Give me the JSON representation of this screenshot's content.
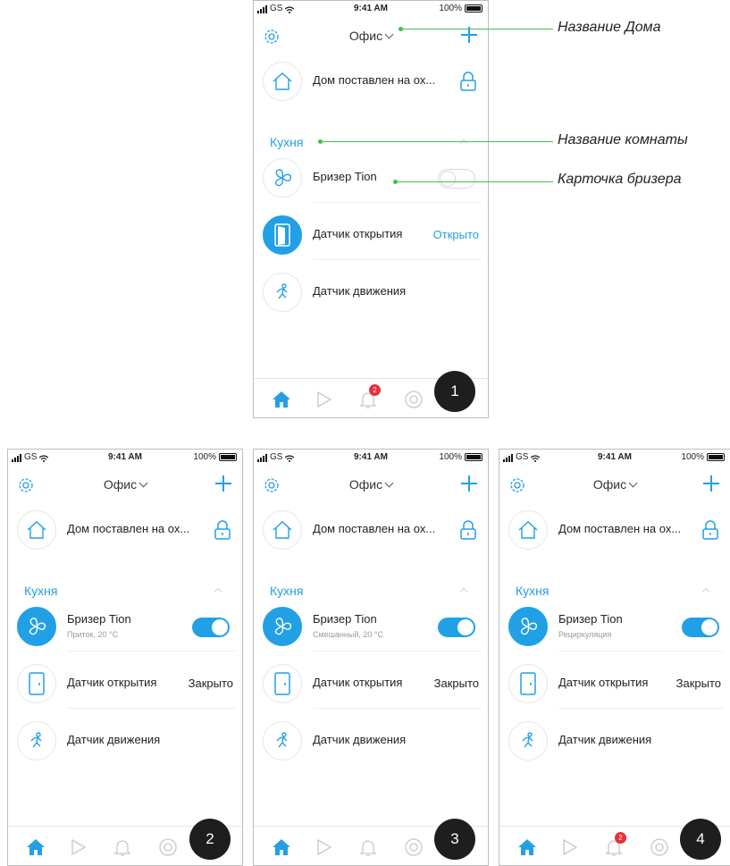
{
  "status": {
    "carrier": "GS",
    "time": "9:41 AM",
    "battery": "100%"
  },
  "app": {
    "home_name": "Офис",
    "home_status": "Дом поставлен на ох...",
    "room": "Кухня"
  },
  "devices": {
    "breezer": "Бризер Tion",
    "door": "Датчик открытия",
    "motion": "Датчик движения"
  },
  "screens": [
    {
      "step": "1",
      "breezer_on": false,
      "breezer_mode": "",
      "door_state": "Открыто",
      "notifications": "2"
    },
    {
      "step": "2",
      "breezer_on": true,
      "breezer_mode": "Приток, 20 °C",
      "door_state": "Закрыто",
      "notifications": ""
    },
    {
      "step": "3",
      "breezer_on": true,
      "breezer_mode": "Смешанный, 20 °C",
      "door_state": "Закрыто",
      "notifications": ""
    },
    {
      "step": "4",
      "breezer_on": true,
      "breezer_mode": "Рециркуляция",
      "door_state": "Закрыто",
      "notifications": "2"
    }
  ],
  "callouts": {
    "home_name": "Название Дома",
    "room_name": "Название комнаты",
    "breezer_card": "Карточка бризера"
  },
  "colors": {
    "accent": "#21a0e6",
    "callout": "#3dc34a",
    "badge": "#e8303a",
    "step_bg": "#1e1e1e"
  },
  "icons": {
    "settings": "gear-icon",
    "add": "plus-icon",
    "home": "house-icon",
    "lock": "lock-icon",
    "breezer": "fan-icon",
    "door": "door-icon",
    "motion": "running-person-icon",
    "tabs": [
      "home-tab-icon",
      "play-tab-icon",
      "bell-tab-icon",
      "support-tab-icon",
      "profile-tab-icon"
    ]
  }
}
